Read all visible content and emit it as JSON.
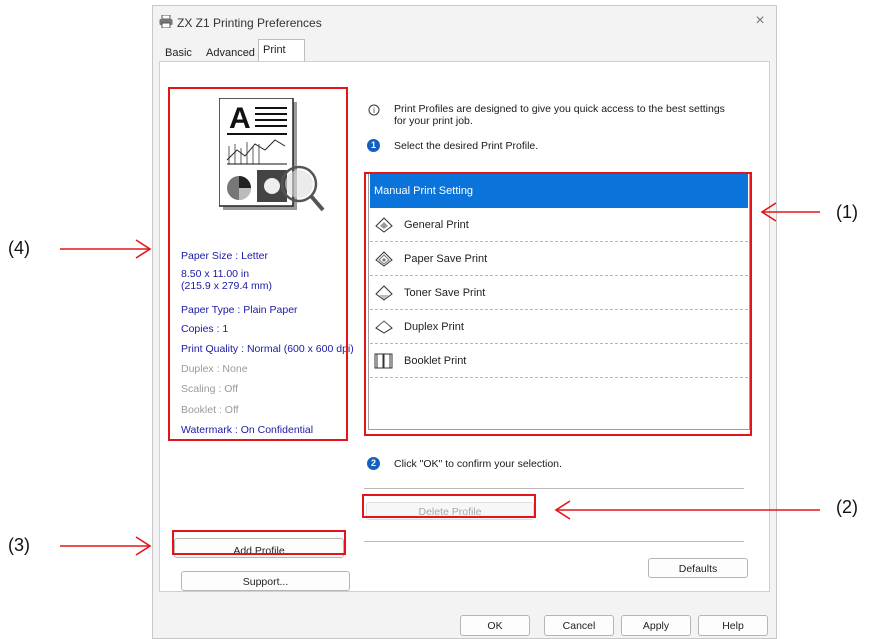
{
  "window": {
    "title": "ZX Z1 Printing Preferences",
    "close_symbol": "×"
  },
  "tabs": [
    {
      "label": "Basic"
    },
    {
      "label": "Advanced"
    },
    {
      "label": "Print Profiles",
      "active": true
    }
  ],
  "intro": {
    "text": "Print Profiles are designed to give you quick access to the best settings for your print job.",
    "step1": "Select the desired Print Profile.",
    "step2": "Click \"OK\" to confirm your selection.",
    "step1_num": "1",
    "step2_num": "2"
  },
  "profiles": [
    {
      "label": "Manual Print Setting",
      "selected": true,
      "icon": "none"
    },
    {
      "label": "General Print",
      "icon": "general-print-icon"
    },
    {
      "label": "Paper Save Print",
      "icon": "paper-save-icon"
    },
    {
      "label": "Toner Save Print",
      "icon": "toner-save-icon"
    },
    {
      "label": "Duplex Print",
      "icon": "duplex-icon"
    },
    {
      "label": "Booklet Print",
      "icon": "booklet-icon"
    }
  ],
  "settings": {
    "paper_size": "Paper Size : Letter",
    "dimensions": "8.50 x 11.00 in\n(215.9 x 279.4 mm)",
    "paper_type": "Paper Type : Plain Paper",
    "copies": "Copies : 1",
    "print_quality": "Print Quality : Normal (600 x 600 dpi)",
    "duplex": "Duplex : None",
    "scaling": "Scaling : Off",
    "booklet": "Booklet : Off",
    "watermark": "Watermark : On Confidential"
  },
  "buttons": {
    "delete_profile": "Delete Profile",
    "add_profile": "Add Profile",
    "support": "Support...",
    "defaults": "Defaults",
    "ok": "OK",
    "cancel": "Cancel",
    "apply": "Apply",
    "help": "Help"
  },
  "callouts": {
    "c1": "(1)",
    "c2": "(2)",
    "c3": "(3)",
    "c4": "(4)"
  },
  "colors": {
    "highlight": "#e3151a",
    "selection": "#0a74da",
    "info_text": "#1a1aa6"
  }
}
